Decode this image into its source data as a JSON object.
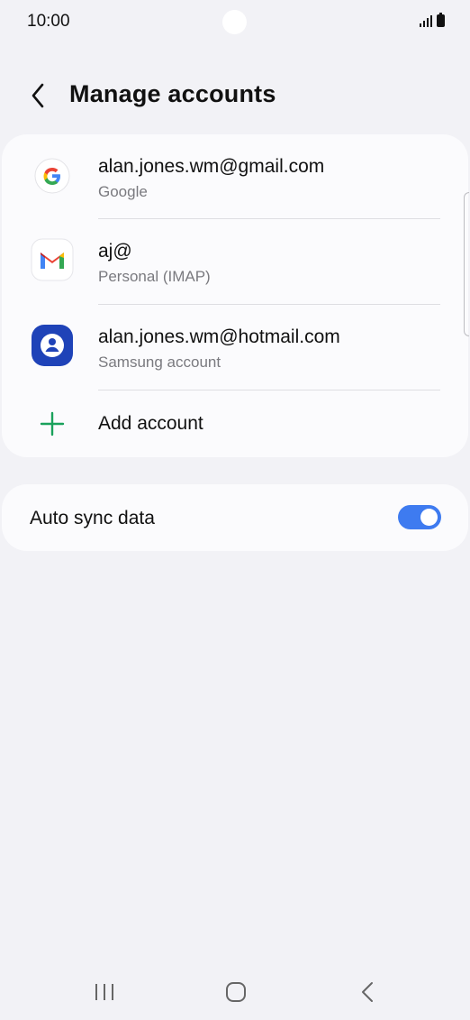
{
  "status_bar": {
    "time": "10:00",
    "icons": [
      "signal-icon",
      "battery-icon"
    ]
  },
  "header": {
    "back_icon": "chevron-left-icon",
    "title": "Manage accounts"
  },
  "accounts": [
    {
      "icon": "google-icon",
      "email": "alan.jones.wm@gmail.com",
      "type": "Google"
    },
    {
      "icon": "gmail-icon",
      "email": "aj@",
      "type": "Personal (IMAP)"
    },
    {
      "icon": "samsung-account-icon",
      "email": "alan.jones.wm@hotmail.com",
      "type": "Samsung account"
    }
  ],
  "add_account": {
    "icon": "plus-icon",
    "label": "Add account"
  },
  "auto_sync": {
    "label": "Auto sync data",
    "enabled": true
  },
  "nav_bar": {
    "icons": [
      "recents-icon",
      "home-icon",
      "back-icon"
    ]
  },
  "colors": {
    "accent": "#3e7bf0",
    "add_green": "#1aa15c",
    "background": "#f2f2f6"
  }
}
